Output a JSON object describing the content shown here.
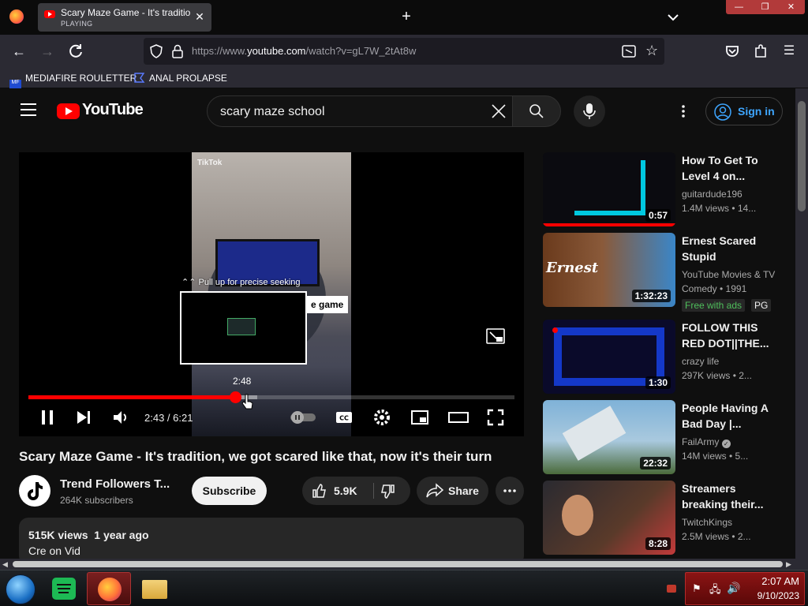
{
  "browser": {
    "tab": {
      "title": "Scary Maze Game - It's tradition",
      "status": "PLAYING"
    },
    "url": {
      "prefix": "https://www.",
      "domain": "youtube.com",
      "path": "/watch?v=gL7W_2tAt8w"
    },
    "bookmarks": [
      {
        "label": "MEDIAFIRE ROULETTER",
        "icon": "mediafire-icon"
      },
      {
        "label": "ANAL PROLAPSE",
        "icon": "bookmark-icon"
      }
    ]
  },
  "youtube": {
    "logo_text": "YouTube",
    "search_value": "scary maze school",
    "signin_label": "Sign in"
  },
  "player": {
    "watermark": "TikTok",
    "seek_hint": "Pull up for precise seeking",
    "caption_chip": "e game",
    "preview_time": "2:48",
    "time_display": "2:43 / 6:21",
    "progress_fraction": 0.426,
    "buffer_fraction": 0.47
  },
  "video": {
    "title": "Scary Maze Game - It's tradition, we got scared like that, now it's their turn",
    "channel_name": "Trend Followers T...",
    "subscribers": "264K subscribers",
    "subscribe_label": "Subscribe",
    "likes": "5.9K",
    "share_label": "Share",
    "views": "515K views",
    "age": "1 year ago",
    "description_line": "Cre on Vid"
  },
  "recommendations": [
    {
      "title": "How To Get To Level 4 on...",
      "channel": "guitardude196",
      "meta": "1.4M views  • 14...",
      "duration": "0:57",
      "colors": [
        "#0b0b10",
        "#00c8e0"
      ]
    },
    {
      "title": "Ernest Scared Stupid",
      "channel": "YouTube Movies & TV",
      "meta": "Comedy • 1991",
      "duration": "1:32:23",
      "badge_free": "Free with ads",
      "badge_rating": "PG",
      "colors": [
        "#6a3a1c",
        "#3a86c8"
      ]
    },
    {
      "title": "FOLLOW THIS RED DOT||THE...",
      "channel": "crazy life",
      "meta": "297K views  • 2...",
      "duration": "1:30",
      "colors": [
        "#1438c8",
        "#0a0a2a"
      ]
    },
    {
      "title": "People Having A Bad Day |...",
      "channel": "FailArmy",
      "meta": "14M views  • 5...",
      "duration": "22:32",
      "colors": [
        "#7fb2d8",
        "#4a6a3a"
      ]
    },
    {
      "title": "Streamers breaking their...",
      "channel": "TwitchKings",
      "meta": "2.5M views  • 2...",
      "duration": "8:28",
      "colors": [
        "#2a2a30",
        "#5a3a2a"
      ]
    }
  ],
  "taskbar": {
    "time": "2:07 AM",
    "date": "9/10/2023"
  }
}
